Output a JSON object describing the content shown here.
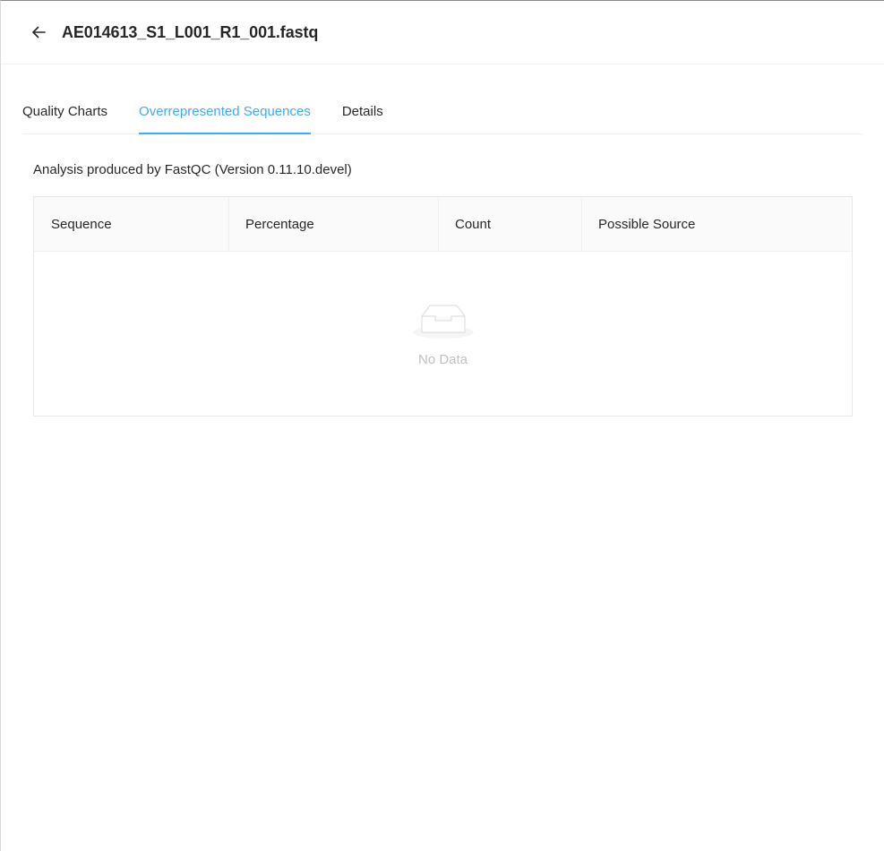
{
  "header": {
    "back_icon": "arrow-left-icon",
    "title": "AE014613_S1_L001_R1_001.fastq"
  },
  "tabs": [
    {
      "label": "Quality Charts",
      "active": false
    },
    {
      "label": "Overrepresented Sequences",
      "active": true
    },
    {
      "label": "Details",
      "active": false
    }
  ],
  "meta": {
    "analysis_text": "Analysis produced by FastQC (Version 0.11.10.devel)"
  },
  "table": {
    "columns": [
      "Sequence",
      "Percentage",
      "Count",
      "Possible Source"
    ],
    "rows": [],
    "empty_text": "No Data",
    "empty_icon": "empty-inbox-icon"
  },
  "colors": {
    "accent": "#40a9ff",
    "border": "#f0f0f0",
    "header_bg": "#fafafa"
  }
}
